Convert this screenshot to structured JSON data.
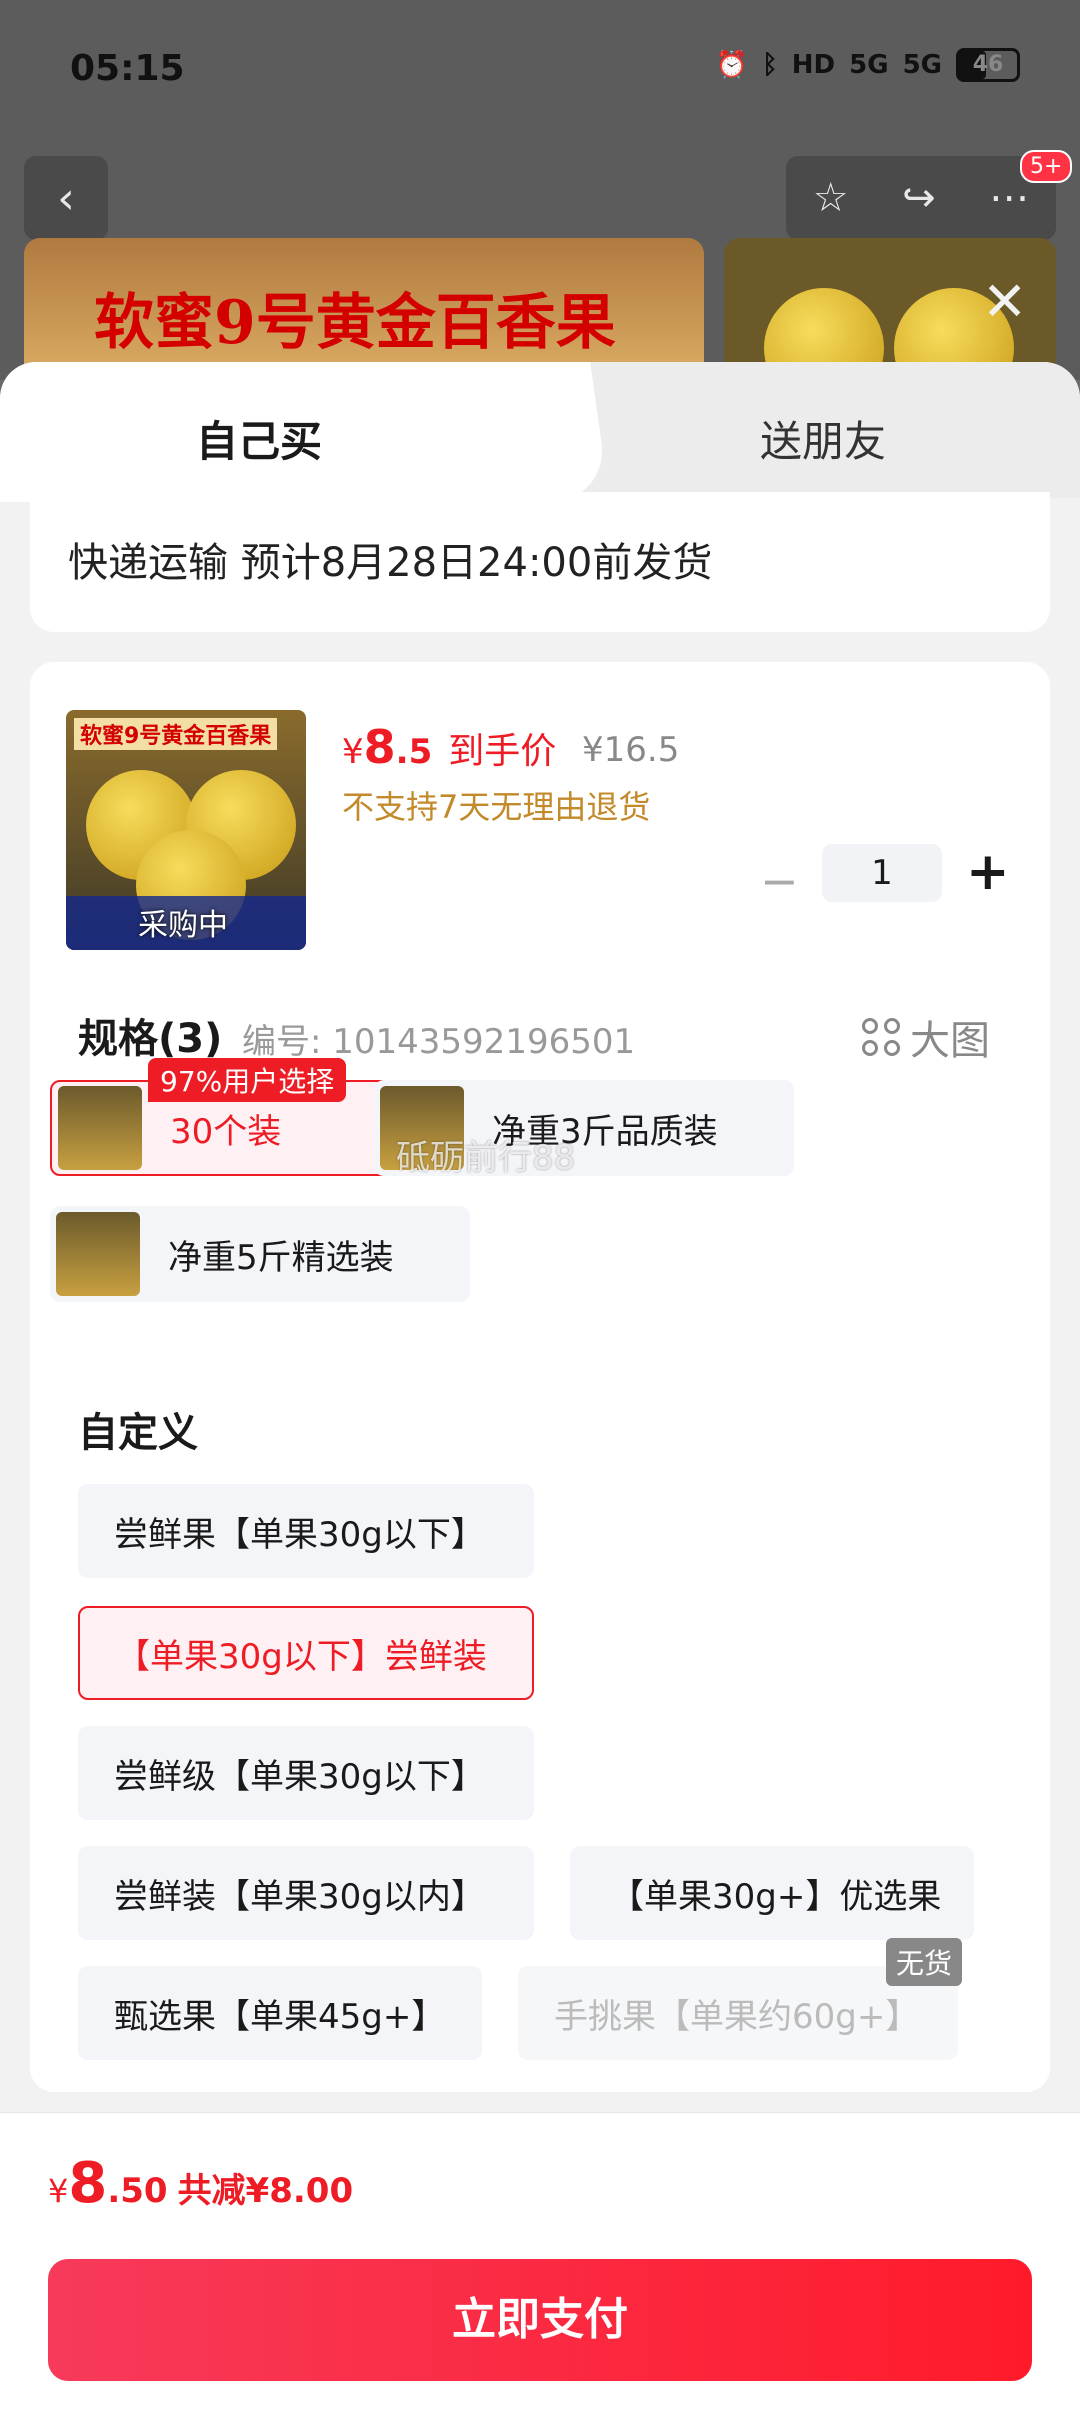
{
  "status_bar": {
    "time": "05:15",
    "hd": "HD",
    "net1": "5G",
    "net2": "5G",
    "battery": "46",
    "battery_level": 0.46
  },
  "top_nav": {
    "cart_badge": "5+"
  },
  "banner": {
    "title": "软蜜9号黄金百香果"
  },
  "tabs": [
    {
      "label": "自己买",
      "active": true
    },
    {
      "label": "送朋友",
      "active": false
    }
  ],
  "shipping": {
    "text": "快递运输 预计8月28日24:00前发货"
  },
  "product": {
    "image_title": "软蜜9号黄金百香果",
    "image_tag": "采购中",
    "price_symbol": "¥",
    "price_int": "8",
    "price_dec": ".5",
    "price_label": "到手价",
    "original_price": "¥16.5",
    "return_policy": "不支持7天无理由退货",
    "quantity": "1",
    "minus": "−",
    "plus": "+"
  },
  "spec": {
    "title": "规格(3)",
    "code": "编号: 10143592196501",
    "big_image_label": "大图",
    "popular_tag": "97%用户选择",
    "options": [
      {
        "label": "30个装",
        "selected": true
      },
      {
        "label": "净重3斤品质装",
        "selected": false
      },
      {
        "label": "净重5斤精选装",
        "selected": false
      }
    ]
  },
  "custom": {
    "title": "自定义",
    "out_of_stock": "无货",
    "options": [
      {
        "label": "尝鲜果【单果30g以下】",
        "selected": false
      },
      {
        "label": "【单果30g以下】尝鲜装",
        "selected": true
      },
      {
        "label": "尝鲜级【单果30g以下】",
        "selected": false
      },
      {
        "label": "尝鲜装【单果30g以内】",
        "selected": false
      },
      {
        "label": "【单果30g+】优选果",
        "selected": false
      },
      {
        "label": "甄选果【单果45g+】",
        "selected": false
      },
      {
        "label": "手挑果【单果约60g+】",
        "disabled": true
      }
    ]
  },
  "watermark": "砥砺前行88",
  "footer": {
    "symbol": "¥",
    "total_int": "8",
    "total_dec": ".50",
    "savings": "共减¥8.00",
    "pay_button": "立即支付"
  },
  "colors": {
    "accent": "#ee1c25",
    "button_gradient_start": "#f73a5a",
    "button_gradient_end": "#ff1a2a",
    "warning": "#c28a2a"
  }
}
